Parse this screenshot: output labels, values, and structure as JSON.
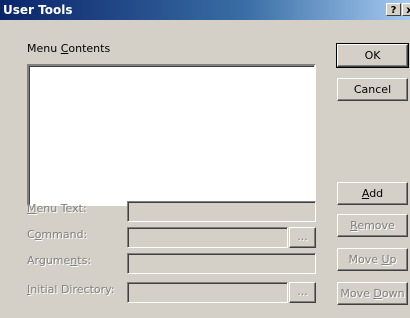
{
  "window": {
    "title": "User Tools",
    "help_button": "?",
    "close_button": "x"
  },
  "menu_contents": {
    "label_pre": "Menu ",
    "label_key": "C",
    "label_post": "ontents"
  },
  "fields": {
    "menu_text": {
      "label_pre": "",
      "label_key": "M",
      "label_post": "enu Text:",
      "value": ""
    },
    "command": {
      "label_pre": "C",
      "label_key": "o",
      "label_post": "mmand:",
      "value": ""
    },
    "arguments": {
      "label_pre": "Argume",
      "label_key": "n",
      "label_post": "ts:",
      "value": ""
    },
    "initial_directory": {
      "label_pre": "",
      "label_key": "I",
      "label_post": "nitial Directory:",
      "value": ""
    }
  },
  "browse_label": "...",
  "buttons": {
    "ok": {
      "pre": "OK",
      "key": "",
      "post": ""
    },
    "cancel": {
      "pre": "Cancel",
      "key": "",
      "post": ""
    },
    "add": {
      "pre": "",
      "key": "A",
      "post": "dd"
    },
    "remove": {
      "pre": "",
      "key": "R",
      "post": "emove"
    },
    "move_up": {
      "pre": "Move ",
      "key": "U",
      "post": "p"
    },
    "move_down": {
      "pre": "Move ",
      "key": "D",
      "post": "own"
    }
  }
}
